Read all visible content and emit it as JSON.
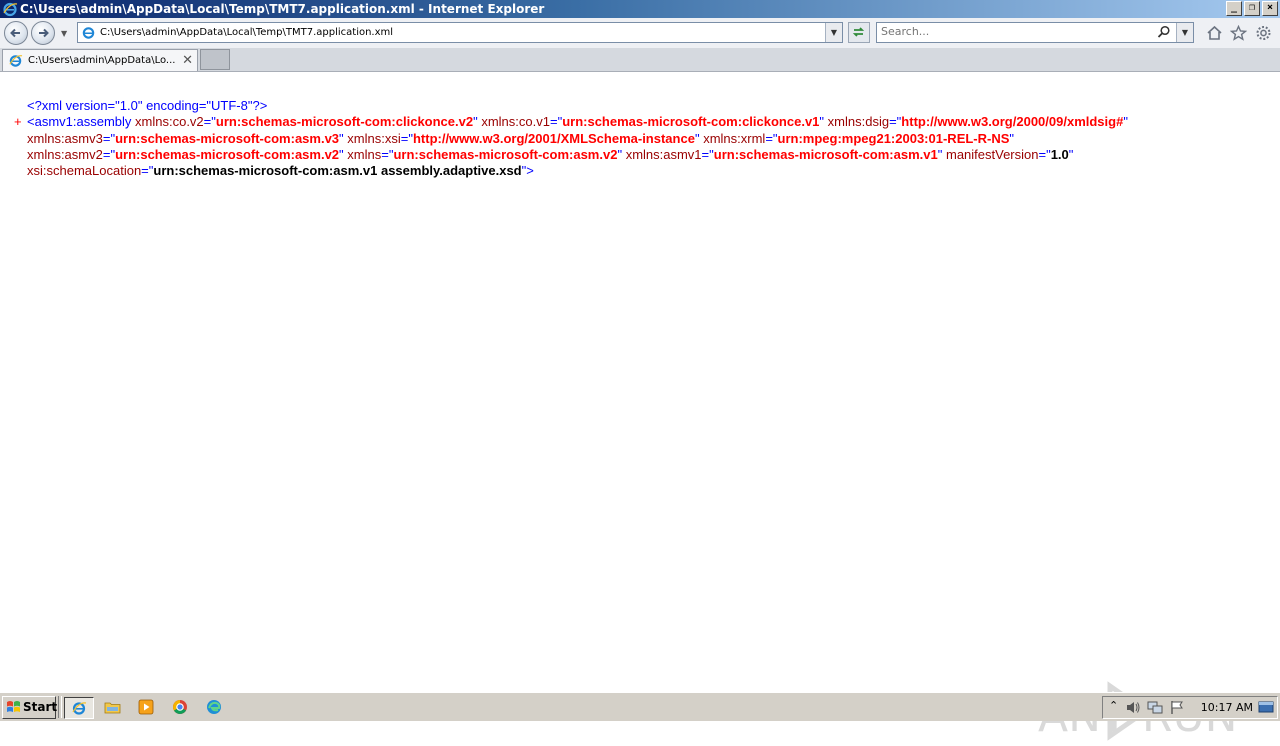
{
  "window": {
    "title": "C:\\Users\\admin\\AppData\\Local\\Temp\\TMT7.application.xml - Internet Explorer",
    "controls": {
      "minimize": "_",
      "restore": "❐",
      "close": "×"
    }
  },
  "navbar": {
    "address": "C:\\Users\\admin\\AppData\\Local\\Temp\\TMT7.application.xml",
    "search_placeholder": "Search..."
  },
  "tabs": [
    {
      "label": "C:\\Users\\admin\\AppData\\Lo...",
      "active": true
    }
  ],
  "xml": {
    "pi": "<?xml version=\"1.0\" encoding=\"UTF-8\"?>",
    "toggle": "+",
    "open": "<",
    "tag": "asmv1:assembly",
    "close": ">",
    "eq": "=\"",
    "quote": "\"",
    "attributes": [
      {
        "name": "xmlns:co.v2",
        "value": "urn:schemas-microsoft-com:clickonce.v2"
      },
      {
        "name": "xmlns:co.v1",
        "value": "urn:schemas-microsoft-com:clickonce.v1"
      },
      {
        "name": "xmlns:dsig",
        "value": "http://www.w3.org/2000/09/xmldsig#"
      },
      {
        "name": "xmlns:asmv3",
        "value": "urn:schemas-microsoft-com:asm.v3"
      },
      {
        "name": "xmlns:xsi",
        "value": "http://www.w3.org/2001/XMLSchema-instance"
      },
      {
        "name": "xmlns:xrml",
        "value": "urn:mpeg:mpeg21:2003:01-REL-R-NS"
      },
      {
        "name": "xmlns:asmv2",
        "value": "urn:schemas-microsoft-com:asm.v2"
      },
      {
        "name": "xmlns",
        "value": "urn:schemas-microsoft-com:asm.v2"
      },
      {
        "name": "xmlns:asmv1",
        "value": "urn:schemas-microsoft-com:asm.v1"
      },
      {
        "name": "manifestVersion",
        "value": "1.0"
      },
      {
        "name": "xsi:schemaLocation",
        "value": "urn:schemas-microsoft-com:asm.v1 assembly.adaptive.xsd"
      }
    ]
  },
  "watermark": "ANY RUN",
  "taskbar": {
    "start_label": "Start",
    "clock": "10:17 AM"
  }
}
